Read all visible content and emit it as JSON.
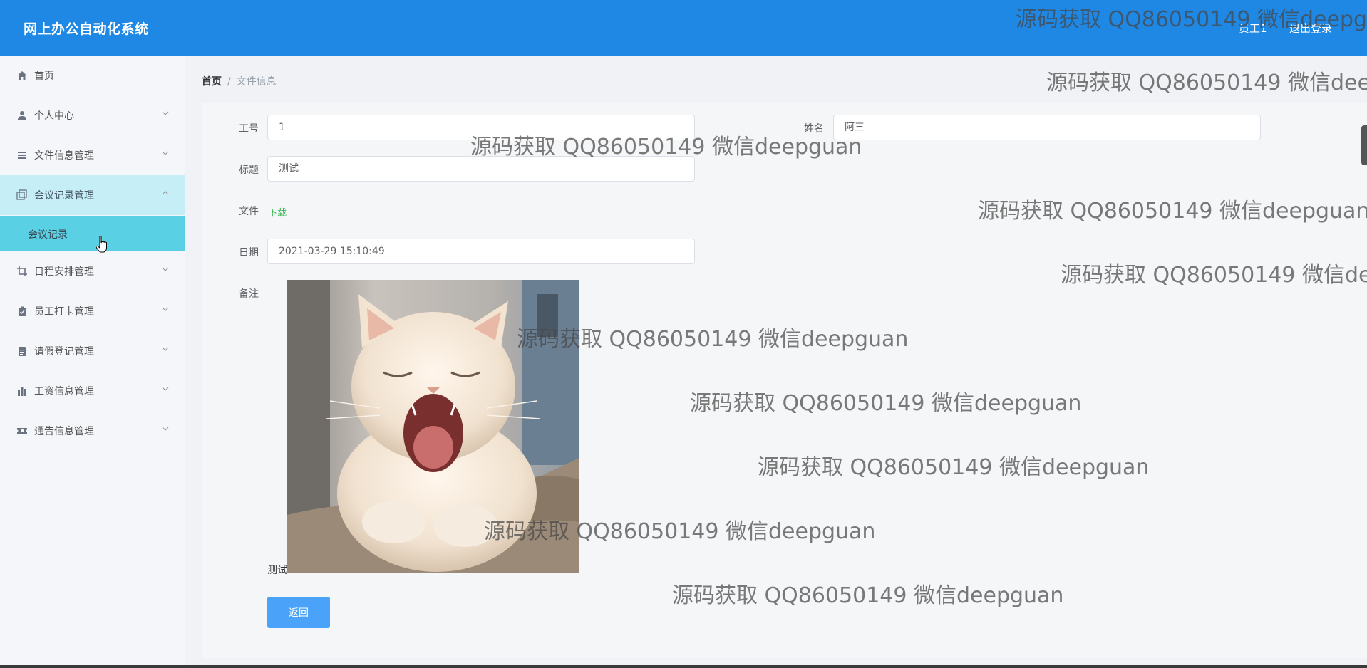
{
  "header": {
    "app_title": "网上办公自动化系统",
    "user": "员工1",
    "logout": "退出登录",
    "brand_color": "#1f88e5"
  },
  "sidebar": {
    "items": [
      {
        "label": "首页",
        "icon": "home-icon"
      },
      {
        "label": "个人中心",
        "icon": "user-icon"
      },
      {
        "label": "文件信息管理",
        "icon": "list-icon"
      },
      {
        "label": "会议记录管理",
        "icon": "copy-icon",
        "open": true
      },
      {
        "label": "日程安排管理",
        "icon": "crop-icon"
      },
      {
        "label": "员工打卡管理",
        "icon": "clipboard-icon"
      },
      {
        "label": "请假登记管理",
        "icon": "document-icon"
      },
      {
        "label": "工资信息管理",
        "icon": "bar-chart-icon"
      },
      {
        "label": "通告信息管理",
        "icon": "ticket-icon"
      }
    ],
    "submenu": {
      "label": "会议记录"
    }
  },
  "breadcrumb": {
    "home": "首页",
    "separator": "/",
    "current": "文件信息"
  },
  "form": {
    "employee_id_label": "工号",
    "employee_id_value": "1",
    "name_label": "姓名",
    "name_value": "阿三",
    "title_label": "标题",
    "title_value": "测试",
    "file_label": "文件",
    "file_link": "下载",
    "date_label": "日期",
    "date_value": "2021-03-29 15:10:49",
    "remark_label": "备注",
    "remark_text": "测试",
    "back_button": "返回"
  },
  "watermark": "源码获取 QQ86050149 微信deepguan"
}
